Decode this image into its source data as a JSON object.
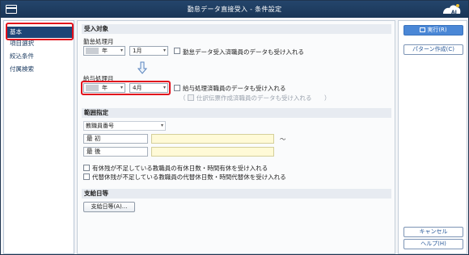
{
  "window": {
    "title": "勤怠データ直接受入 - 条件設定"
  },
  "sidebar": {
    "items": [
      {
        "label": "基本"
      },
      {
        "label": "項目選択"
      },
      {
        "label": "絞込条件"
      },
      {
        "label": "付属検索"
      }
    ]
  },
  "accept_target": {
    "header": "受入対象",
    "attendance": {
      "label": "勤怠処理月",
      "year_suffix": "年",
      "month": "1月",
      "include_retired_label": "勤怠データ受入済職員のデータも受け入れる"
    },
    "payroll": {
      "label": "給与処理月",
      "year_suffix": "年",
      "month": "4月",
      "include_processed_label": "給与処理済職員のデータも受け入れる",
      "journal_label": "仕訳伝票作成済職員のデータも受け入れる",
      "journal_open": "（",
      "journal_close": "）"
    }
  },
  "range": {
    "header": "範囲指定",
    "field_select": "教職員番号",
    "first_label": "最 初",
    "last_label": "最 後",
    "tilde": "～",
    "option1_label": "有休残が不足している教職員の有休日数・時間有休を受け入れる",
    "option2_label": "代替休残が不足している教職員の代替休日数・時間代替休を受け入れる"
  },
  "payment": {
    "header": "支給日等",
    "button_label": "支給日等(A)..."
  },
  "actions": {
    "execute": "実行(R)",
    "create_pattern": "パターン作成(C)",
    "cancel": "キャンセル",
    "help": "ヘルプ(H)"
  },
  "colors": {
    "titlebar": "#1f3e63",
    "accent": "#1e4576",
    "highlight": "#e2101c",
    "execute_button": "#4a87d6"
  }
}
